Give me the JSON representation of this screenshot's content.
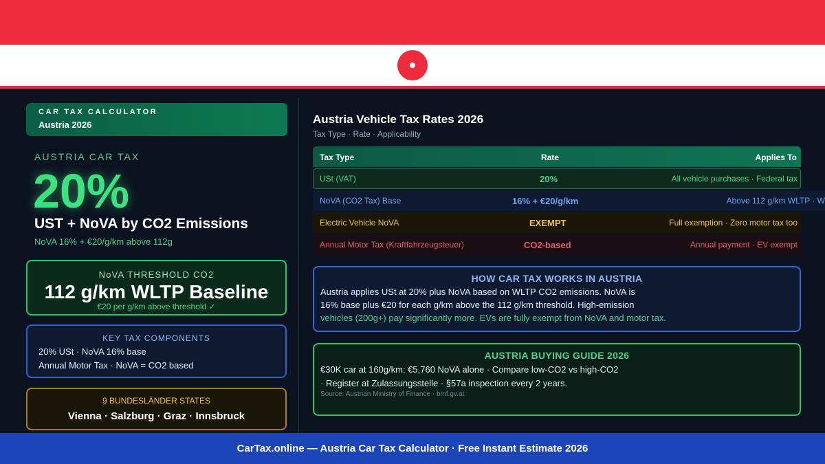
{
  "flag": {
    "colors": [
      "#ee2a3d",
      "#ffffff",
      "#ee2a3d"
    ],
    "emblem_icon": "red-circle-dot-icon"
  },
  "brand": {
    "title": "CAR TAX CALCULATOR",
    "subtitle": "Austria 2026"
  },
  "hero": {
    "kicker": "AUSTRIA CAR TAX",
    "rate": "20%",
    "headline": "UST + NoVA by CO2 Emissions",
    "subline": "NoVA 16% + €20/g/km above 112g"
  },
  "threshold": {
    "label": "NoVA THRESHOLD CO2",
    "value": "112 g/km WLTP Baseline",
    "note": "€20 per g/km above threshold ✓"
  },
  "components": {
    "title": "KEY TAX COMPONENTS",
    "lines": [
      "20% USt · NoVA 16% base",
      "Annual Motor Tax · NoVA = CO2 based"
    ]
  },
  "states": {
    "title": "9 BUNDESLÄNDER STATES",
    "list": "Vienna · Salzburg · Graz · Innsbruck"
  },
  "table": {
    "title": "Austria Vehicle Tax Rates 2026",
    "subtitle": "Tax Type · Rate · Applicability",
    "headers": [
      "Tax Type",
      "Rate",
      "Applies To"
    ],
    "rows": [
      {
        "type": "USt (VAT)",
        "rate": "20%",
        "applies": "All vehicle purchases · Federal tax",
        "color": "#4fd08f"
      },
      {
        "type": "NoVA (CO2 Tax) Base",
        "rate": "16% + €20/g/km",
        "applies": "Above 112 g/km WLTP · W",
        "color": "#6fa3f0"
      },
      {
        "type": "Electric Vehicle NoVA",
        "rate": "EXEMPT",
        "applies": "Full exemption · Zero motor tax too",
        "color": "#f0c04a"
      },
      {
        "type": "Annual Motor Tax (Kraftfahrzeugsteuer)",
        "rate": "CO2-based",
        "applies": "Annual payment · EV exempt",
        "color": "#e05e6a"
      }
    ]
  },
  "how": {
    "title": "HOW CAR TAX WORKS IN AUSTRIA",
    "lines": [
      "Austria applies USt at 20% plus NoVA based on WLTP CO2 emissions. NoVA is",
      "16% base plus €20 for each g/km above the 112 g/km threshold. High-emission",
      "vehicles (200g+) pay significantly more. EVs are fully exempt from NoVA and motor tax."
    ]
  },
  "guide": {
    "title": "AUSTRIA BUYING GUIDE 2026",
    "lines": [
      "€30K car at 160g/km: €5,760 NoVA alone · Compare low-CO2 vs high-CO2",
      "· Register at Zulassungsstelle · §57a inspection every 2 years."
    ],
    "source": "Source: Austrian Ministry of Finance · bmf.gv.at"
  },
  "footer": {
    "text": "CarTax.online — Austria Car Tax Calculator · Free Instant Estimate 2026"
  }
}
